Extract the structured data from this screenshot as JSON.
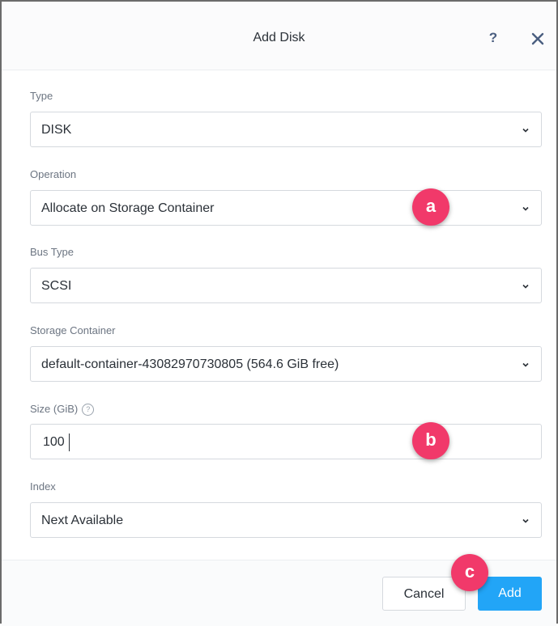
{
  "dialog": {
    "title": "Add Disk",
    "help_icon": "help-icon",
    "close_icon": "close-icon"
  },
  "fields": {
    "type": {
      "label": "Type",
      "value": "DISK"
    },
    "operation": {
      "label": "Operation",
      "value": "Allocate on Storage Container"
    },
    "bus_type": {
      "label": "Bus Type",
      "value": "SCSI"
    },
    "storage_container": {
      "label": "Storage Container",
      "value": "default-container-43082970730805 (564.6 GiB free)"
    },
    "size": {
      "label": "Size (GiB)",
      "value": "100",
      "info_glyph": "?"
    },
    "index": {
      "label": "Index",
      "value": "Next Available"
    }
  },
  "footer": {
    "cancel_label": "Cancel",
    "add_label": "Add"
  },
  "annotations": {
    "a": "a",
    "b": "b",
    "c": "c"
  },
  "colors": {
    "primary": "#22a5f7",
    "marker": "#f1396a"
  }
}
